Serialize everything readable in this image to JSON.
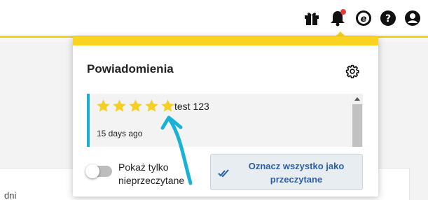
{
  "header": {
    "icons": [
      "gift-icon",
      "bell-icon",
      "coupon-icon",
      "help-icon",
      "user-icon"
    ],
    "has_unread_dot": true
  },
  "background": {
    "partial_text": "dni"
  },
  "notifications_panel": {
    "title": "Powiadomienia",
    "settings_icon": "gear-icon",
    "items": [
      {
        "rating": 5,
        "rating_max": 5,
        "text": "test 123",
        "time": "15 days ago"
      }
    ],
    "toggle_label": "Pokaż tylko nieprzeczytane",
    "toggle_on": false,
    "mark_all_label": "Oznacz wszystko jako przeczytane"
  },
  "colors": {
    "accent_yellow": "#fad320",
    "item_border": "#1cb0d0",
    "star": "#f5cf26",
    "link_blue": "#2a5ea8",
    "annotation_arrow": "#17b2d6",
    "notification_dot": "#e33b3b"
  }
}
